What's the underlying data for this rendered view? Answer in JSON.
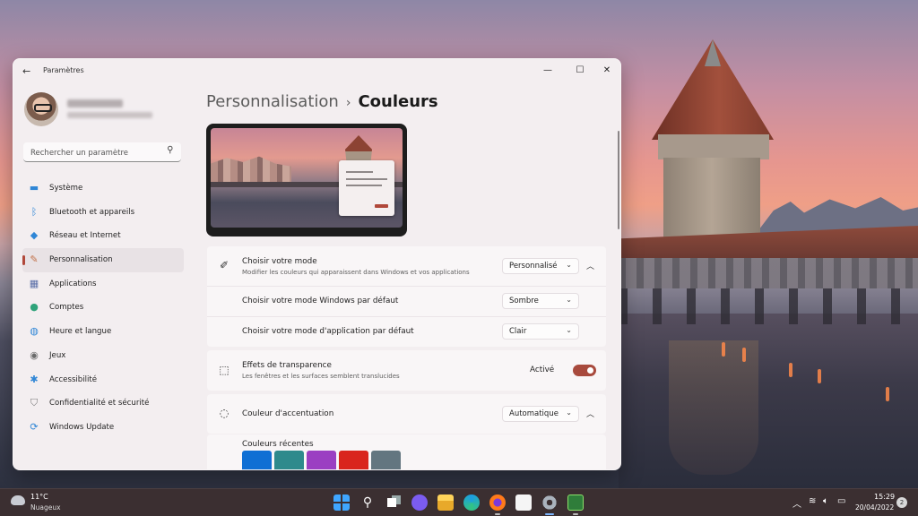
{
  "window": {
    "title": "Paramètres"
  },
  "search": {
    "placeholder": "Rechercher un paramètre"
  },
  "sidebar": {
    "items": [
      {
        "label": "Système",
        "icon": "monitor-icon"
      },
      {
        "label": "Bluetooth et appareils",
        "icon": "bluetooth-icon"
      },
      {
        "label": "Réseau et Internet",
        "icon": "wifi-icon"
      },
      {
        "label": "Personnalisation",
        "icon": "brush-icon",
        "active": true
      },
      {
        "label": "Applications",
        "icon": "apps-icon"
      },
      {
        "label": "Comptes",
        "icon": "account-icon"
      },
      {
        "label": "Heure et langue",
        "icon": "globe-clock-icon"
      },
      {
        "label": "Jeux",
        "icon": "gamepad-icon"
      },
      {
        "label": "Accessibilité",
        "icon": "accessibility-icon"
      },
      {
        "label": "Confidentialité et sécurité",
        "icon": "shield-icon"
      },
      {
        "label": "Windows Update",
        "icon": "update-icon"
      }
    ]
  },
  "breadcrumb": {
    "parent": "Personnalisation",
    "separator": "›",
    "current": "Couleurs"
  },
  "mode_card": {
    "title": "Choisir votre mode",
    "subtitle": "Modifier les couleurs qui apparaissent dans Windows et vos applications",
    "value": "Personnalisé",
    "windows_mode": {
      "label": "Choisir votre mode Windows par défaut",
      "value": "Sombre"
    },
    "app_mode": {
      "label": "Choisir votre mode d'application par défaut",
      "value": "Clair"
    }
  },
  "transparency_card": {
    "title": "Effets de transparence",
    "subtitle": "Les fenêtres et les surfaces semblent translucides",
    "toggle_label": "Activé",
    "toggle_on": true
  },
  "accent_card": {
    "title": "Couleur d'accentuation",
    "value": "Automatique",
    "recent_label": "Couleurs récentes",
    "recent_colors": [
      "#0f6fd4",
      "#2e8a8c",
      "#9b3fc2",
      "#d9251d",
      "#637680"
    ]
  },
  "colors": {
    "accent": "#a84a3d"
  },
  "taskbar": {
    "weather_temp": "11°C",
    "weather_desc": "Nuageux",
    "time": "15:29",
    "date": "20/04/2022",
    "notifications": "2"
  }
}
